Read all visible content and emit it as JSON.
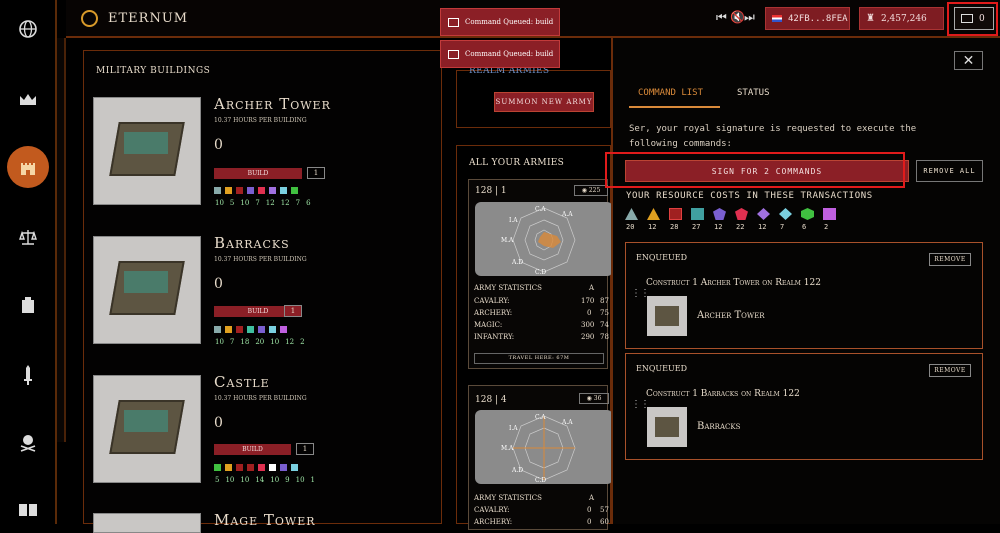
{
  "topbar": {
    "brand": "ETERNUM",
    "toasts": [
      "Command Queued: build",
      "Command Queued: build"
    ],
    "address": "42FB...8FEA",
    "balance": "2,457,246",
    "queue_count": "0"
  },
  "left_panel": {
    "title": "MILITARY BUILDINGS",
    "buildings": [
      {
        "name": "Archer Tower",
        "hours": "10.37 HOURS PER BUILDING",
        "count": "0",
        "build_label": "BUILD",
        "qty": "1",
        "resources": [
          "10",
          "5",
          "10",
          "7",
          "12",
          "12",
          "7",
          "6"
        ]
      },
      {
        "name": "Barracks",
        "hours": "10.37 HOURS PER BUILDING",
        "count": "0",
        "build_label": "BUILD",
        "qty": "1",
        "resources": [
          "10",
          "7",
          "18",
          "20",
          "10",
          "12",
          "2"
        ]
      },
      {
        "name": "Castle",
        "hours": "10.37 HOURS PER BUILDING",
        "count": "0",
        "build_label": "BUILD",
        "qty": "1",
        "resources": [
          "5",
          "10",
          "10",
          "14",
          "10",
          "9",
          "10",
          "1"
        ]
      },
      {
        "name": "Mage Tower"
      }
    ]
  },
  "middle_panel": {
    "realm_armies": "REALM ARMIES",
    "summon": "SUMMON NEW ARMY",
    "all_armies": "ALL YOUR ARMIES",
    "armies": [
      {
        "id": "128 | 1",
        "badge": "225",
        "stats_header": "ARMY STATISTICS",
        "col": "A",
        "rows": [
          {
            "k": "CAVALRY:",
            "a": "170",
            "b": "87"
          },
          {
            "k": "ARCHERY:",
            "a": "0",
            "b": "75"
          },
          {
            "k": "MAGIC:",
            "a": "300",
            "b": "74"
          },
          {
            "k": "INFANTRY:",
            "a": "290",
            "b": "78"
          }
        ],
        "travel": "TRAVEL HERE: 67M"
      },
      {
        "id": "128 | 4",
        "badge": "36",
        "stats_header": "ARMY STATISTICS",
        "col": "A",
        "rows": [
          {
            "k": "CAVALRY:",
            "a": "0",
            "b": "57"
          },
          {
            "k": "ARCHERY:",
            "a": "0",
            "b": "60"
          }
        ]
      }
    ],
    "radar_labels": [
      "C.A",
      "A.A",
      "I.A",
      "M.A",
      "A.D",
      "C.D"
    ]
  },
  "drawer": {
    "tabs": [
      "COMMAND LIST",
      "STATUS"
    ],
    "description": "Ser, your royal signature is requested to execute the following commands:",
    "sign": "SIGN FOR 2 COMMANDS",
    "remove_all": "REMOVE ALL",
    "resource_title": "YOUR RESOURCE COSTS IN THESE TRANSACTIONS",
    "resource_values": [
      "20",
      "12",
      "28",
      "27",
      "12",
      "22",
      "12",
      "7",
      "6",
      "2"
    ],
    "queue": [
      {
        "status": "ENQUEUED",
        "remove": "REMOVE",
        "title": "Construct 1 Archer Tower on Realm 122",
        "name": "Archer Tower"
      },
      {
        "status": "ENQUEUED",
        "remove": "REMOVE",
        "title": "Construct 1 Barracks on Realm 122",
        "name": "Barracks"
      }
    ]
  }
}
